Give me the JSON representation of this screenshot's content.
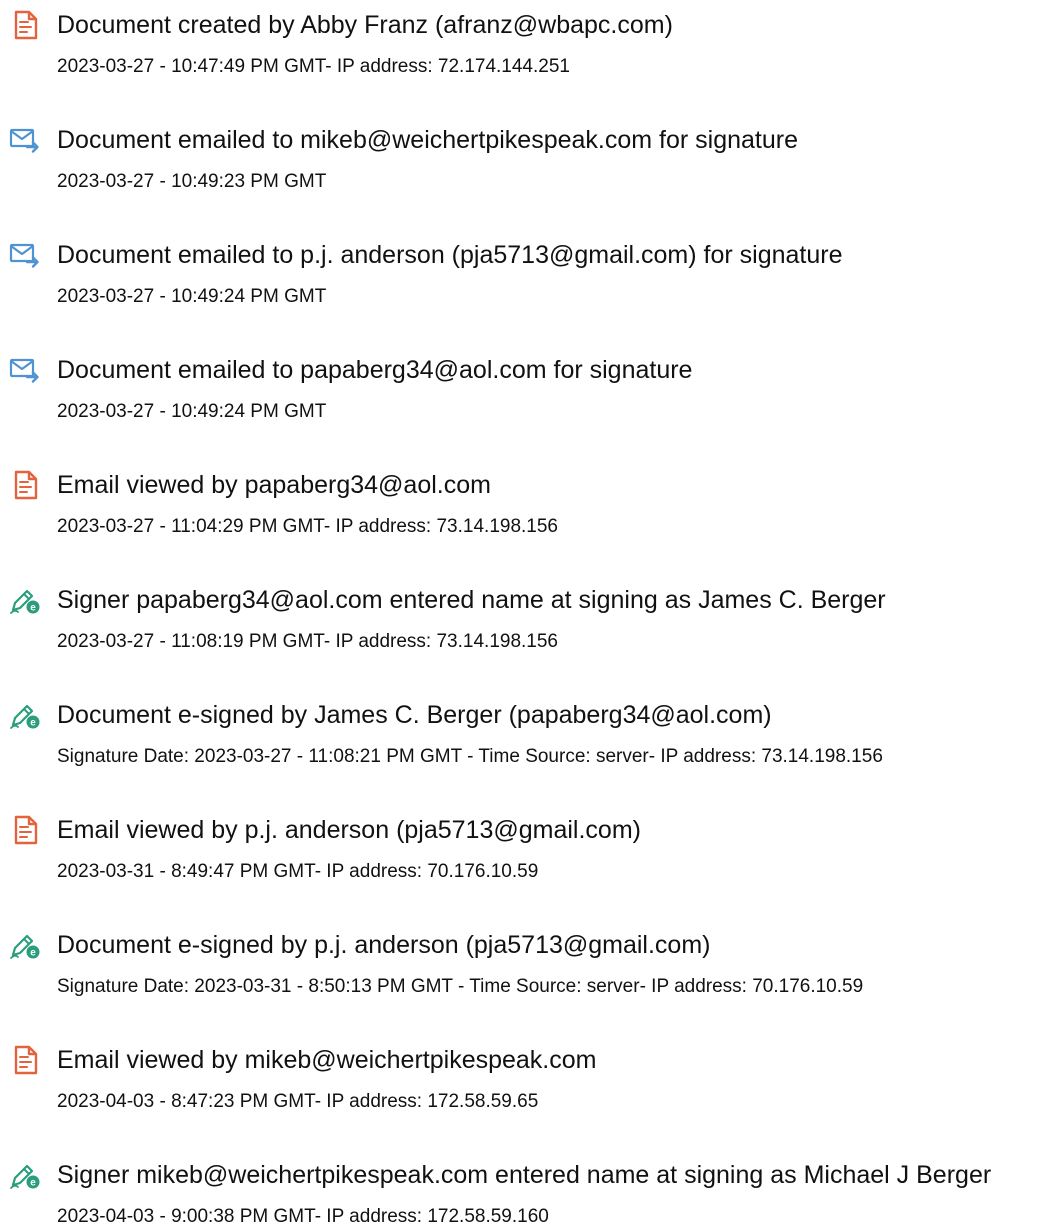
{
  "colors": {
    "document_icon": "#e3643c",
    "email_icon": "#4f93d2",
    "sign_icon": "#2a9d7c",
    "text": "#111111"
  },
  "events": [
    {
      "icon": "document-icon",
      "title": "Document created by Abby Franz (afranz@wbapc.com)",
      "detail": "2023-03-27 - 10:47:49 PM GMT- IP address: 72.174.144.251"
    },
    {
      "icon": "email-send-icon",
      "title": "Document emailed to mikeb@weichertpikespeak.com for signature",
      "detail": "2023-03-27 - 10:49:23 PM GMT"
    },
    {
      "icon": "email-send-icon",
      "title": "Document emailed to p.j. anderson (pja5713@gmail.com) for signature",
      "detail": "2023-03-27 - 10:49:24 PM GMT"
    },
    {
      "icon": "email-send-icon",
      "title": "Document emailed to papaberg34@aol.com for signature",
      "detail": "2023-03-27 - 10:49:24 PM GMT"
    },
    {
      "icon": "document-icon",
      "title": "Email viewed by papaberg34@aol.com",
      "detail": "2023-03-27 - 11:04:29 PM GMT- IP address: 73.14.198.156"
    },
    {
      "icon": "esign-pen-icon",
      "title": "Signer papaberg34@aol.com entered name at signing as James C. Berger",
      "detail": "2023-03-27 - 11:08:19 PM GMT- IP address: 73.14.198.156"
    },
    {
      "icon": "esign-pen-icon",
      "title": "Document e-signed by James C. Berger (papaberg34@aol.com)",
      "detail": "Signature Date: 2023-03-27 - 11:08:21 PM GMT - Time Source: server- IP address: 73.14.198.156"
    },
    {
      "icon": "document-icon",
      "title": "Email viewed by p.j. anderson (pja5713@gmail.com)",
      "detail": "2023-03-31 - 8:49:47 PM GMT- IP address: 70.176.10.59"
    },
    {
      "icon": "esign-pen-icon",
      "title": "Document e-signed by p.j. anderson (pja5713@gmail.com)",
      "detail": "Signature Date: 2023-03-31 - 8:50:13 PM GMT - Time Source: server- IP address: 70.176.10.59"
    },
    {
      "icon": "document-icon",
      "title": "Email viewed by mikeb@weichertpikespeak.com",
      "detail": "2023-04-03 - 8:47:23 PM GMT- IP address: 172.58.59.65"
    },
    {
      "icon": "esign-pen-icon",
      "title": "Signer mikeb@weichertpikespeak.com entered name at signing as Michael J Berger",
      "detail": "2023-04-03 - 9:00:38 PM GMT- IP address: 172.58.59.160"
    }
  ]
}
